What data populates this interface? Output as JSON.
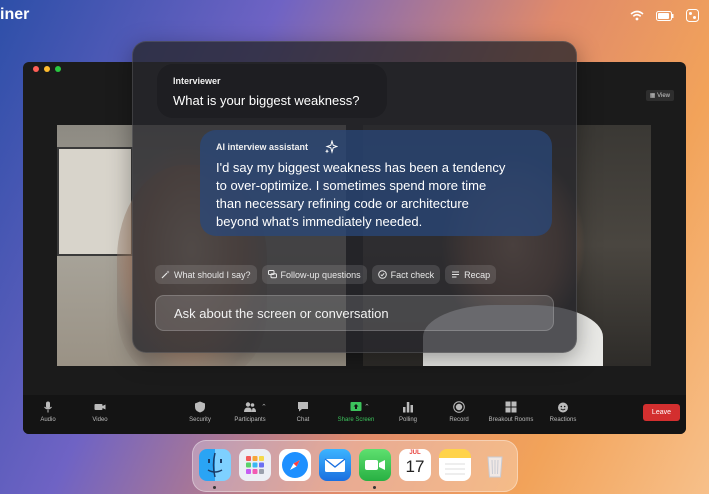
{
  "menubar": {
    "app_name": "iner",
    "icons": [
      "wifi-icon",
      "battery-icon",
      "control-center-icon"
    ]
  },
  "zoom": {
    "view_label": "View",
    "toolbar": {
      "audio": "Audio",
      "video": "Video",
      "security": "Security",
      "participants": "Participants",
      "chat": "Chat",
      "share_screen": "Share Screen",
      "polling": "Polling",
      "record": "Record",
      "breakout_rooms": "Breakout Rooms",
      "reactions": "Reactions",
      "leave": "Leave"
    },
    "colors": {
      "share_screen": "#3cc35c",
      "leave": "#d32f2f"
    }
  },
  "assistant": {
    "interviewer_label": "Interviewer",
    "question": "What is your biggest weakness?",
    "ai_label": "AI interview assistant",
    "answer_lines": [
      "I'd say my biggest weakness has been a tendency",
      "to over-optimize. I sometimes spend more time",
      "than necessary refining code or architecture",
      "beyond what's immediately needed."
    ],
    "chips": [
      "What should I say?",
      "Follow-up questions",
      "Fact check",
      "Recap"
    ],
    "ask_placeholder": "Ask about the screen or conversation"
  },
  "dock": {
    "items": [
      "finder-icon",
      "launchpad-icon",
      "safari-icon",
      "mail-icon",
      "facetime-icon",
      "calendar-icon",
      "notes-icon",
      "trash-icon"
    ],
    "calendar": {
      "month": "JUL",
      "day": "17"
    }
  }
}
